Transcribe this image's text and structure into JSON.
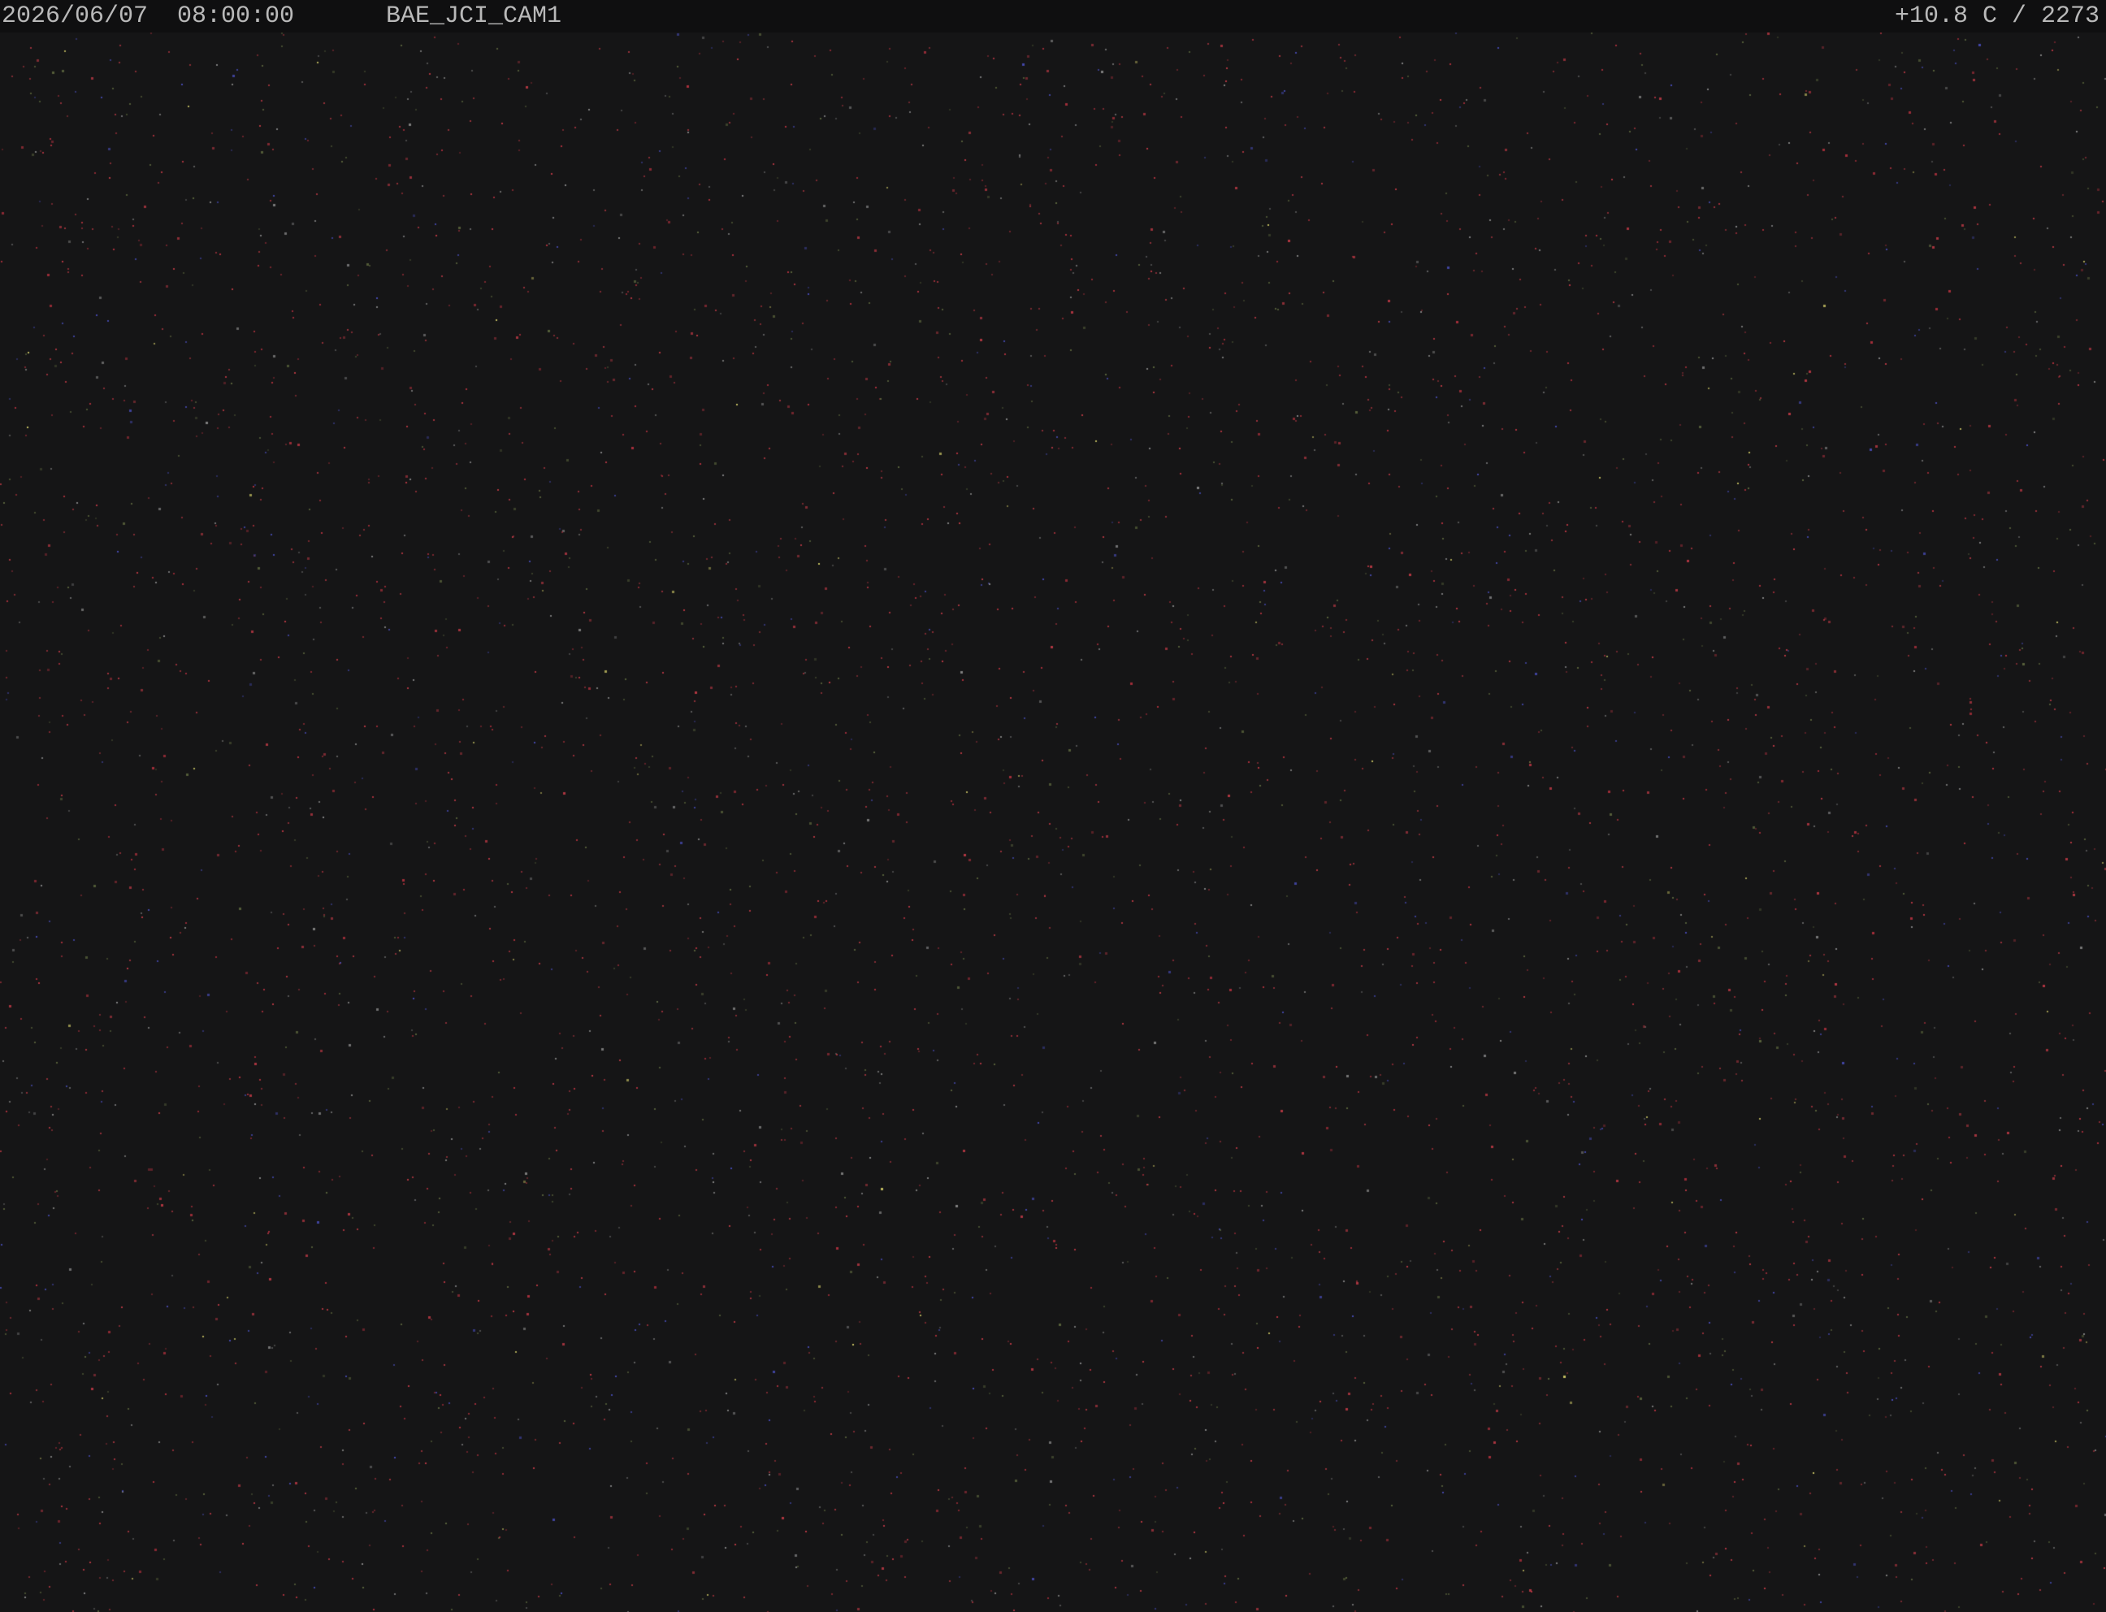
{
  "osd": {
    "timestamp": "2026/06/07  08:00:00",
    "camera_id": "BAE_JCI_CAM1",
    "sensor_readout": "+10.8 C / 2273"
  },
  "feed": {
    "background_color": "#151516",
    "osd_bar_color": "#0f0f10",
    "osd_text_color": "#b9b9b9",
    "noise_colors": [
      "#c23a46",
      "#b8323f",
      "#4a4fbf",
      "#5f6a3f",
      "#8c8c8c",
      "#d8d26a"
    ]
  }
}
